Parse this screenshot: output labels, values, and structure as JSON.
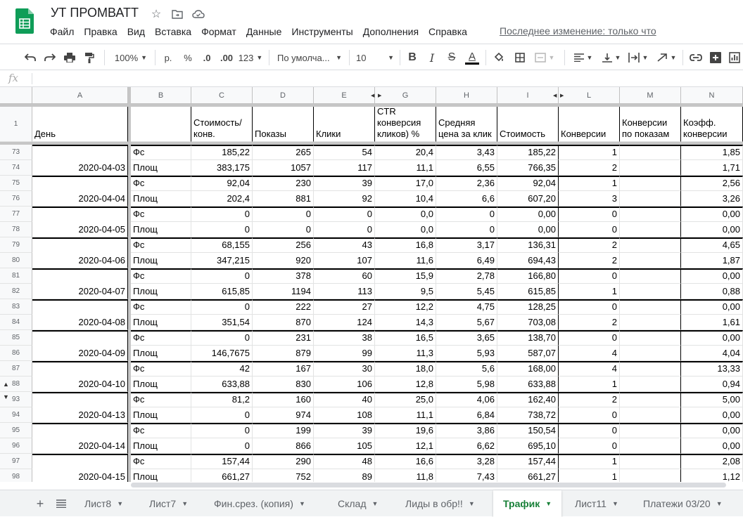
{
  "header": {
    "title": "УТ ПРОМВАТТ",
    "menu": [
      "Файл",
      "Правка",
      "Вид",
      "Вставка",
      "Формат",
      "Данные",
      "Инструменты",
      "Дополнения",
      "Справка"
    ],
    "last_edit": "Последнее изменение: только что"
  },
  "toolbar": {
    "zoom": "100%",
    "currency": "р.",
    "percent": "%",
    "dec_less": ".0",
    "dec_more": ".00",
    "more_formats": "123",
    "font": "По умолча...",
    "font_size": "10"
  },
  "formula_bar": {
    "fx": "fx"
  },
  "columns": [
    "A",
    "B",
    "C",
    "D",
    "E",
    "G",
    "H",
    "I",
    "L",
    "M",
    "N"
  ],
  "header_row": {
    "row_number": "1",
    "cells": [
      "День",
      "",
      "Стоимость/конв.",
      "Показы",
      "Клики",
      "CTR конверсия кликов) %",
      "Средняя цена за клик",
      "Стоимость",
      "Конверсии",
      "Конверсии по показам",
      "Коэфф. конверсии"
    ]
  },
  "rows": [
    {
      "n": "73",
      "date": "",
      "b": "Фс",
      "c": "185,22",
      "d": "265",
      "e": "54",
      "g": "20,4",
      "h": "3,43",
      "i": "185,22",
      "l": "1",
      "m": "",
      "nv": "1,85"
    },
    {
      "n": "74",
      "date": "2020-04-03",
      "b": "Площ",
      "c": "383,175",
      "d": "1057",
      "e": "117",
      "g": "11,1",
      "h": "6,55",
      "i": "766,35",
      "l": "2",
      "m": "",
      "nv": "1,71"
    },
    {
      "n": "75",
      "date": "",
      "b": "Фс",
      "c": "92,04",
      "d": "230",
      "e": "39",
      "g": "17,0",
      "h": "2,36",
      "i": "92,04",
      "l": "1",
      "m": "",
      "nv": "2,56"
    },
    {
      "n": "76",
      "date": "2020-04-04",
      "b": "Площ",
      "c": "202,4",
      "d": "881",
      "e": "92",
      "g": "10,4",
      "h": "6,6",
      "i": "607,20",
      "l": "3",
      "m": "",
      "nv": "3,26"
    },
    {
      "n": "77",
      "date": "",
      "b": "Фс",
      "c": "0",
      "d": "0",
      "e": "0",
      "g": "0,0",
      "h": "0",
      "i": "0,00",
      "l": "0",
      "m": "",
      "nv": "0,00"
    },
    {
      "n": "78",
      "date": "2020-04-05",
      "b": "Площ",
      "c": "0",
      "d": "0",
      "e": "0",
      "g": "0,0",
      "h": "0",
      "i": "0,00",
      "l": "0",
      "m": "",
      "nv": "0,00"
    },
    {
      "n": "79",
      "date": "",
      "b": "Фс",
      "c": "68,155",
      "d": "256",
      "e": "43",
      "g": "16,8",
      "h": "3,17",
      "i": "136,31",
      "l": "2",
      "m": "",
      "nv": "4,65"
    },
    {
      "n": "80",
      "date": "2020-04-06",
      "b": "Площ",
      "c": "347,215",
      "d": "920",
      "e": "107",
      "g": "11,6",
      "h": "6,49",
      "i": "694,43",
      "l": "2",
      "m": "",
      "nv": "1,87"
    },
    {
      "n": "81",
      "date": "",
      "b": "Фс",
      "c": "0",
      "d": "378",
      "e": "60",
      "g": "15,9",
      "h": "2,78",
      "i": "166,80",
      "l": "0",
      "m": "",
      "nv": "0,00"
    },
    {
      "n": "82",
      "date": "2020-04-07",
      "b": "Площ",
      "c": "615,85",
      "d": "1194",
      "e": "113",
      "g": "9,5",
      "h": "5,45",
      "i": "615,85",
      "l": "1",
      "m": "",
      "nv": "0,88"
    },
    {
      "n": "83",
      "date": "",
      "b": "Фс",
      "c": "0",
      "d": "222",
      "e": "27",
      "g": "12,2",
      "h": "4,75",
      "i": "128,25",
      "l": "0",
      "m": "",
      "nv": "0,00"
    },
    {
      "n": "84",
      "date": "2020-04-08",
      "b": "Площ",
      "c": "351,54",
      "d": "870",
      "e": "124",
      "g": "14,3",
      "h": "5,67",
      "i": "703,08",
      "l": "2",
      "m": "",
      "nv": "1,61"
    },
    {
      "n": "85",
      "date": "",
      "b": "Фс",
      "c": "0",
      "d": "231",
      "e": "38",
      "g": "16,5",
      "h": "3,65",
      "i": "138,70",
      "l": "0",
      "m": "",
      "nv": "0,00"
    },
    {
      "n": "86",
      "date": "2020-04-09",
      "b": "Площ",
      "c": "146,7675",
      "d": "879",
      "e": "99",
      "g": "11,3",
      "h": "5,93",
      "i": "587,07",
      "l": "4",
      "m": "",
      "nv": "4,04"
    },
    {
      "n": "87",
      "date": "",
      "b": "Фс",
      "c": "42",
      "d": "167",
      "e": "30",
      "g": "18,0",
      "h": "5,6",
      "i": "168,00",
      "l": "4",
      "m": "",
      "nv": "13,33"
    },
    {
      "n": "88",
      "date": "2020-04-10",
      "b": "Площ",
      "c": "633,88",
      "d": "830",
      "e": "106",
      "g": "12,8",
      "h": "5,98",
      "i": "633,88",
      "l": "1",
      "m": "",
      "nv": "0,94"
    },
    {
      "n": "93",
      "date": "",
      "b": "Фс",
      "c": "81,2",
      "d": "160",
      "e": "40",
      "g": "25,0",
      "h": "4,06",
      "i": "162,40",
      "l": "2",
      "m": "",
      "nv": "5,00"
    },
    {
      "n": "94",
      "date": "2020-04-13",
      "b": "Площ",
      "c": "0",
      "d": "974",
      "e": "108",
      "g": "11,1",
      "h": "6,84",
      "i": "738,72",
      "l": "0",
      "m": "",
      "nv": "0,00"
    },
    {
      "n": "95",
      "date": "",
      "b": "Фс",
      "c": "0",
      "d": "199",
      "e": "39",
      "g": "19,6",
      "h": "3,86",
      "i": "150,54",
      "l": "0",
      "m": "",
      "nv": "0,00"
    },
    {
      "n": "96",
      "date": "2020-04-14",
      "b": "Площ",
      "c": "0",
      "d": "866",
      "e": "105",
      "g": "12,1",
      "h": "6,62",
      "i": "695,10",
      "l": "0",
      "m": "",
      "nv": "0,00"
    },
    {
      "n": "97",
      "date": "",
      "b": "Фс",
      "c": "157,44",
      "d": "290",
      "e": "48",
      "g": "16,6",
      "h": "3,28",
      "i": "157,44",
      "l": "1",
      "m": "",
      "nv": "2,08"
    },
    {
      "n": "98",
      "date": "2020-04-15",
      "b": "Площ",
      "c": "661,27",
      "d": "752",
      "e": "89",
      "g": "11,8",
      "h": "7,43",
      "i": "661,27",
      "l": "1",
      "m": "",
      "nv": "1,12"
    }
  ],
  "tabs": {
    "items": [
      "Лист8",
      "Лист7",
      "Фин.срез. (копия)",
      "Склад",
      "Лиды в обр!!",
      "Трафик",
      "Лист11",
      "Платежи 03/20"
    ],
    "active": "Трафик"
  },
  "colors": {
    "active_tab": "#188038",
    "logo": "#0f9d58"
  }
}
